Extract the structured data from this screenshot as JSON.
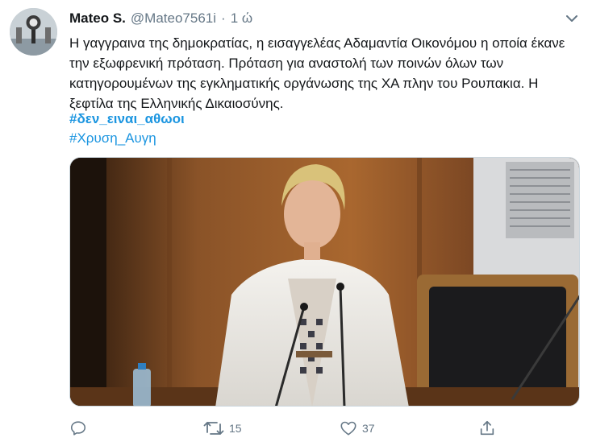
{
  "author": {
    "name": "Mateo S.",
    "handle": "@Mateo7561i",
    "separator": "·",
    "time": "1 ώ"
  },
  "tweet": {
    "text": "Η γαγγραινα της δημοκρατίας, η εισαγγελέας Αδαμαντία Οικονόμου η οποία έκανε την εξωφρενική πρόταση. Πρόταση για αναστολή των ποινών όλων των κατηγορουμένων της εγκληματικής οργάνωσης της ΧΑ πλην του Ρουπακια. Η ξεφτίλα της Ελληνικής Δικαιοσύνης.",
    "hashtags": [
      "#δεν_ειναι_αθωοι",
      "#Χρυση_Αυγη"
    ]
  },
  "actions": {
    "reply_icon": "reply-icon",
    "retweet_icon": "retweet-icon",
    "retweet_count": "15",
    "like_icon": "like-icon",
    "like_count": "37",
    "share_icon": "share-icon"
  },
  "colors": {
    "text": "#14171a",
    "muted": "#657786",
    "link": "#1b95e0"
  }
}
